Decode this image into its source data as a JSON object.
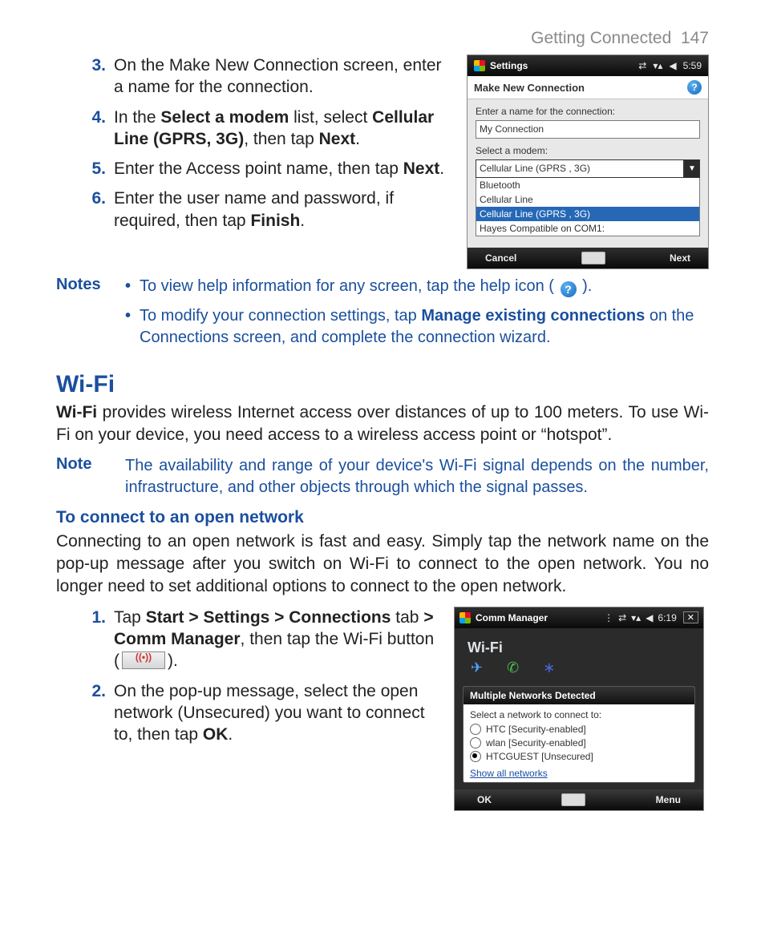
{
  "header": {
    "section": "Getting Connected",
    "page": "147"
  },
  "steps_top": [
    {
      "n": "3.",
      "html": "On the Make New Connection screen, enter a name for the connection."
    },
    {
      "n": "4.",
      "html": "In the <b>Select a modem</b> list, select <b>Cellular Line (GPRS, 3G)</b>, then tap <b>Next</b>."
    },
    {
      "n": "5.",
      "html": "Enter the Access point name, then tap <b>Next</b>."
    },
    {
      "n": "6.",
      "html": "Enter the user name and password, if required, then tap <b>Finish</b>."
    }
  ],
  "notes1": {
    "label": "Notes",
    "items": [
      {
        "pre": "To view help information for any screen, tap the help icon (",
        "post": ")."
      },
      {
        "html": "To modify your connection settings, tap <b>Manage existing connections</b> on the Connections screen, and complete the connection wizard."
      }
    ]
  },
  "wifi": {
    "heading": "Wi-Fi",
    "intro_html": "<b>Wi-Fi</b> provides wireless Internet access over distances of up to 100 meters. To use Wi-Fi on your device, you need access to a wireless access point or “hotspot”.",
    "note_label": "Note",
    "note_text": "The availability and range of your device's Wi-Fi signal depends on the number, infrastructure, and other objects through which the signal passes.",
    "sub_heading": "To connect to an open network",
    "sub_intro": "Connecting to an open network is fast and easy. Simply tap the network name on the pop-up message after you switch on Wi-Fi to connect to the open network. You no longer need to set additional options to connect to the open network.",
    "steps": [
      {
        "n": "1.",
        "pre": "Tap <b>Start > Settings > Connections</b> tab <b>> Comm Manager</b>, then tap the Wi-Fi button (",
        "post": ")."
      },
      {
        "n": "2.",
        "html": "On the pop-up message, select the open network (Unsecured) you want to connect to, then tap <b>OK</b>."
      }
    ]
  },
  "shot1": {
    "title": "Settings",
    "clock": "5:59",
    "subtitle": "Make New Connection",
    "label_name": "Enter a name for the connection:",
    "value_name": "My Connection",
    "label_modem": "Select a modem:",
    "value_modem": "Cellular Line (GPRS , 3G)",
    "options": [
      "Bluetooth",
      "Cellular Line",
      "Cellular Line (GPRS , 3G)",
      "Hayes Compatible on COM1:"
    ],
    "selected_index": 2,
    "btn_left": "Cancel",
    "btn_right": "Next"
  },
  "shot2": {
    "title": "Comm Manager",
    "clock": "6:19",
    "section": "Wi-Fi",
    "popup_title": "Multiple Networks Detected",
    "popup_label": "Select a network to connect to:",
    "networks": [
      {
        "name": "HTC [Security-enabled]",
        "checked": false
      },
      {
        "name": "wlan [Security-enabled]",
        "checked": false
      },
      {
        "name": "HTCGUEST [Unsecured]",
        "checked": true
      }
    ],
    "show_all": "Show all networks",
    "btn_left": "OK",
    "btn_right": "Menu"
  }
}
